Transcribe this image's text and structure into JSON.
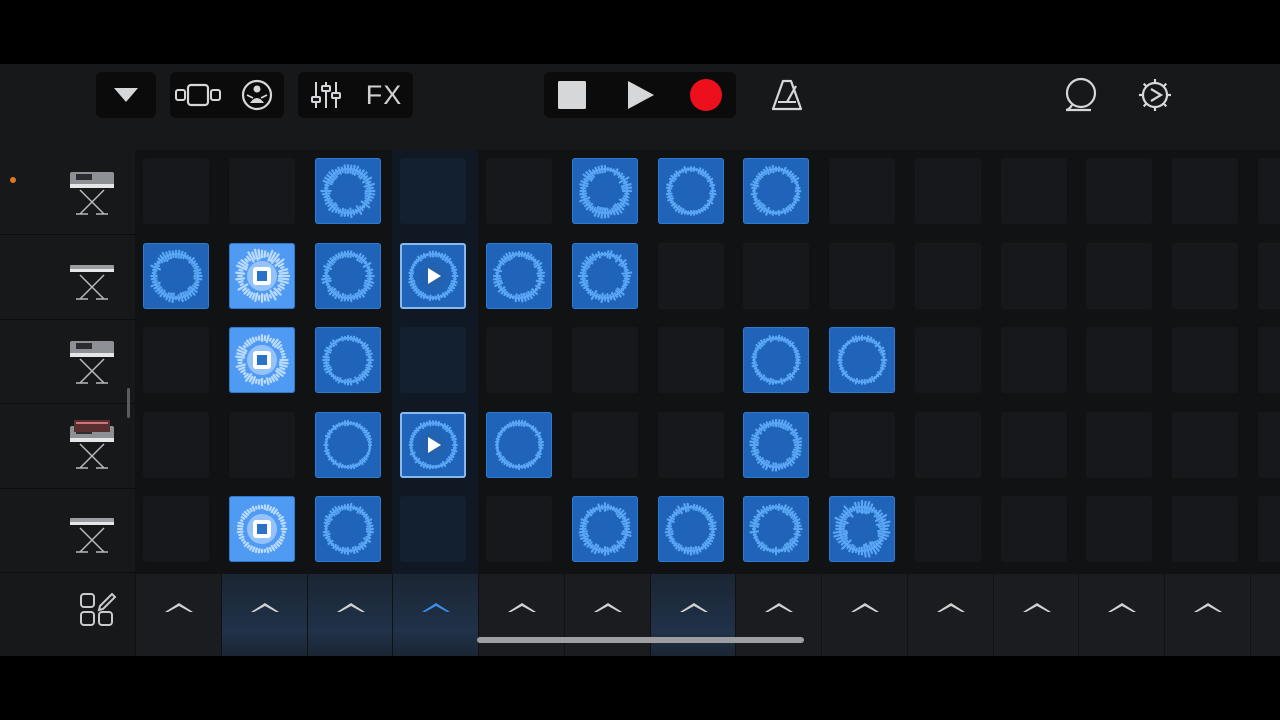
{
  "toolbar": {
    "fx_label": "FX",
    "icons": [
      "browser-dropdown-icon",
      "live-loops-view-icon",
      "drummer-icon",
      "mixer-icon",
      "stop-icon",
      "play-icon",
      "record-icon",
      "metronome-icon",
      "loop-browser-icon",
      "settings-icon"
    ],
    "record_color": "#ee0f1c"
  },
  "tracks": [
    {
      "name": "keyboard-workstation",
      "record_armed": true
    },
    {
      "name": "synth-keyboard",
      "record_armed": false
    },
    {
      "name": "keyboard-workstation",
      "record_armed": false
    },
    {
      "name": "modular-synth",
      "record_armed": false
    },
    {
      "name": "digital-piano",
      "record_armed": false
    }
  ],
  "grid": {
    "highlighted_column": 4,
    "rows": [
      [
        0,
        0,
        1,
        0,
        0,
        1,
        1,
        1,
        0,
        0,
        0,
        0,
        0,
        0
      ],
      [
        1,
        2,
        1,
        3,
        1,
        1,
        0,
        0,
        0,
        0,
        0,
        0,
        0,
        0
      ],
      [
        0,
        2,
        1,
        0,
        0,
        0,
        0,
        1,
        1,
        0,
        0,
        0,
        0,
        0
      ],
      [
        0,
        0,
        1,
        3,
        1,
        0,
        0,
        1,
        0,
        0,
        0,
        0,
        0,
        0
      ],
      [
        0,
        2,
        1,
        0,
        0,
        1,
        1,
        1,
        1,
        0,
        0,
        0,
        0,
        0
      ]
    ],
    "legend": {
      "0": "empty",
      "1": "loop",
      "2": "playing",
      "3": "queued"
    }
  },
  "trigger_bar": {
    "active_columns": [
      2,
      3,
      4,
      7
    ],
    "edit_icon": "edit-cells-icon"
  },
  "colors": {
    "accent": "#3b8fe8",
    "clip": "#1f64b8",
    "clip_playing": "#4f9af2"
  }
}
